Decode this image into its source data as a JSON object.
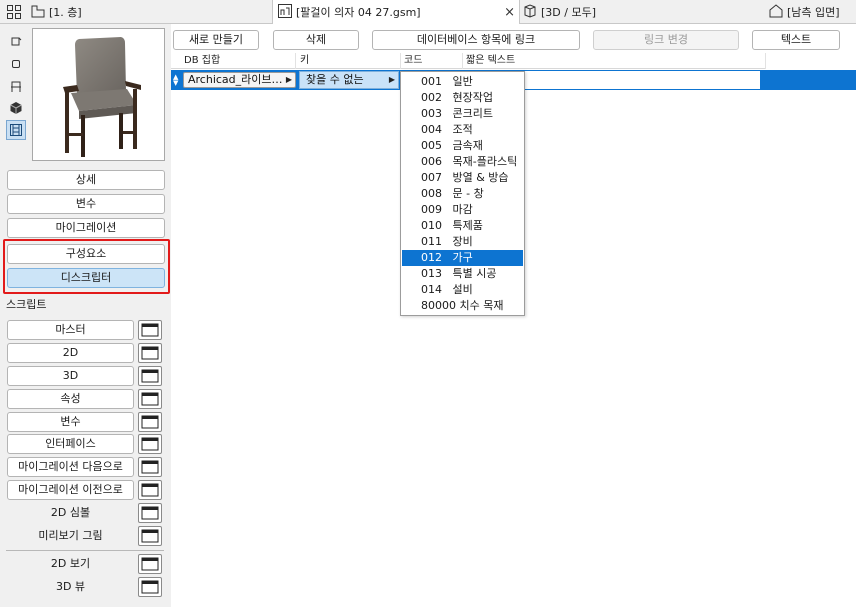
{
  "tabs": [
    {
      "label": "[1. 층]",
      "icon": "floor-plan-icon"
    },
    {
      "label": "[팔걸이 의자 04 27.gsm]",
      "icon": "object-icon",
      "close": "×"
    },
    {
      "label": "[3D / 모두]",
      "icon": "3d-box-icon"
    },
    {
      "label": "[남측 입면]",
      "icon": "elevation-icon"
    }
  ],
  "sidebar": {
    "tools": [
      "2d-symbol-icon",
      "3d-view-icon",
      "chair-icon",
      "cube-icon",
      "film-icon"
    ],
    "preview_alt": "chair-preview",
    "buttons": [
      "상세",
      "변수",
      "마이그레이션",
      "구성요소",
      "디스크립터"
    ],
    "selected_button": "디스크립터",
    "scripts_label": "스크립트",
    "scripts": [
      "마스터",
      "2D",
      "3D",
      "속성",
      "변수",
      "인터페이스",
      "마이그레이션 다음으로",
      "마이그레이션 이전으로"
    ],
    "plain_items": [
      "2D 심볼",
      "미리보기 그림"
    ],
    "bottom_items": [
      "2D 보기",
      "3D 뷰"
    ]
  },
  "toolbar": {
    "new": "새로 만들기",
    "delete": "삭제",
    "link_db": "데이터베이스 항목에 링크",
    "change_link": "링크 변경",
    "text": "텍스트"
  },
  "table": {
    "headers": [
      "DB 집합",
      "키",
      "코드",
      "짧은 텍스트"
    ],
    "row": {
      "db_set": "Archicad_라이브…",
      "key": "찾을 수 없는"
    }
  },
  "menu": {
    "items": [
      {
        "code": "001",
        "label": "일반"
      },
      {
        "code": "002",
        "label": "현장작업"
      },
      {
        "code": "003",
        "label": "콘크리트"
      },
      {
        "code": "004",
        "label": "조적"
      },
      {
        "code": "005",
        "label": "금속재"
      },
      {
        "code": "006",
        "label": "목재-플라스틱"
      },
      {
        "code": "007",
        "label": "방열 & 방습"
      },
      {
        "code": "008",
        "label": "문 -  창"
      },
      {
        "code": "009",
        "label": "마감"
      },
      {
        "code": "010",
        "label": "특제품"
      },
      {
        "code": "011",
        "label": "장비"
      },
      {
        "code": "012",
        "label": "가구"
      },
      {
        "code": "013",
        "label": "특별 시공"
      },
      {
        "code": "014",
        "label": "설비"
      },
      {
        "code": "80000",
        "label": "치수 목재"
      }
    ],
    "selected": "012"
  },
  "colors": {
    "accent": "#0d74d1",
    "highlight_box": "#e21a1a",
    "selected_btn": "#cce4f7"
  }
}
